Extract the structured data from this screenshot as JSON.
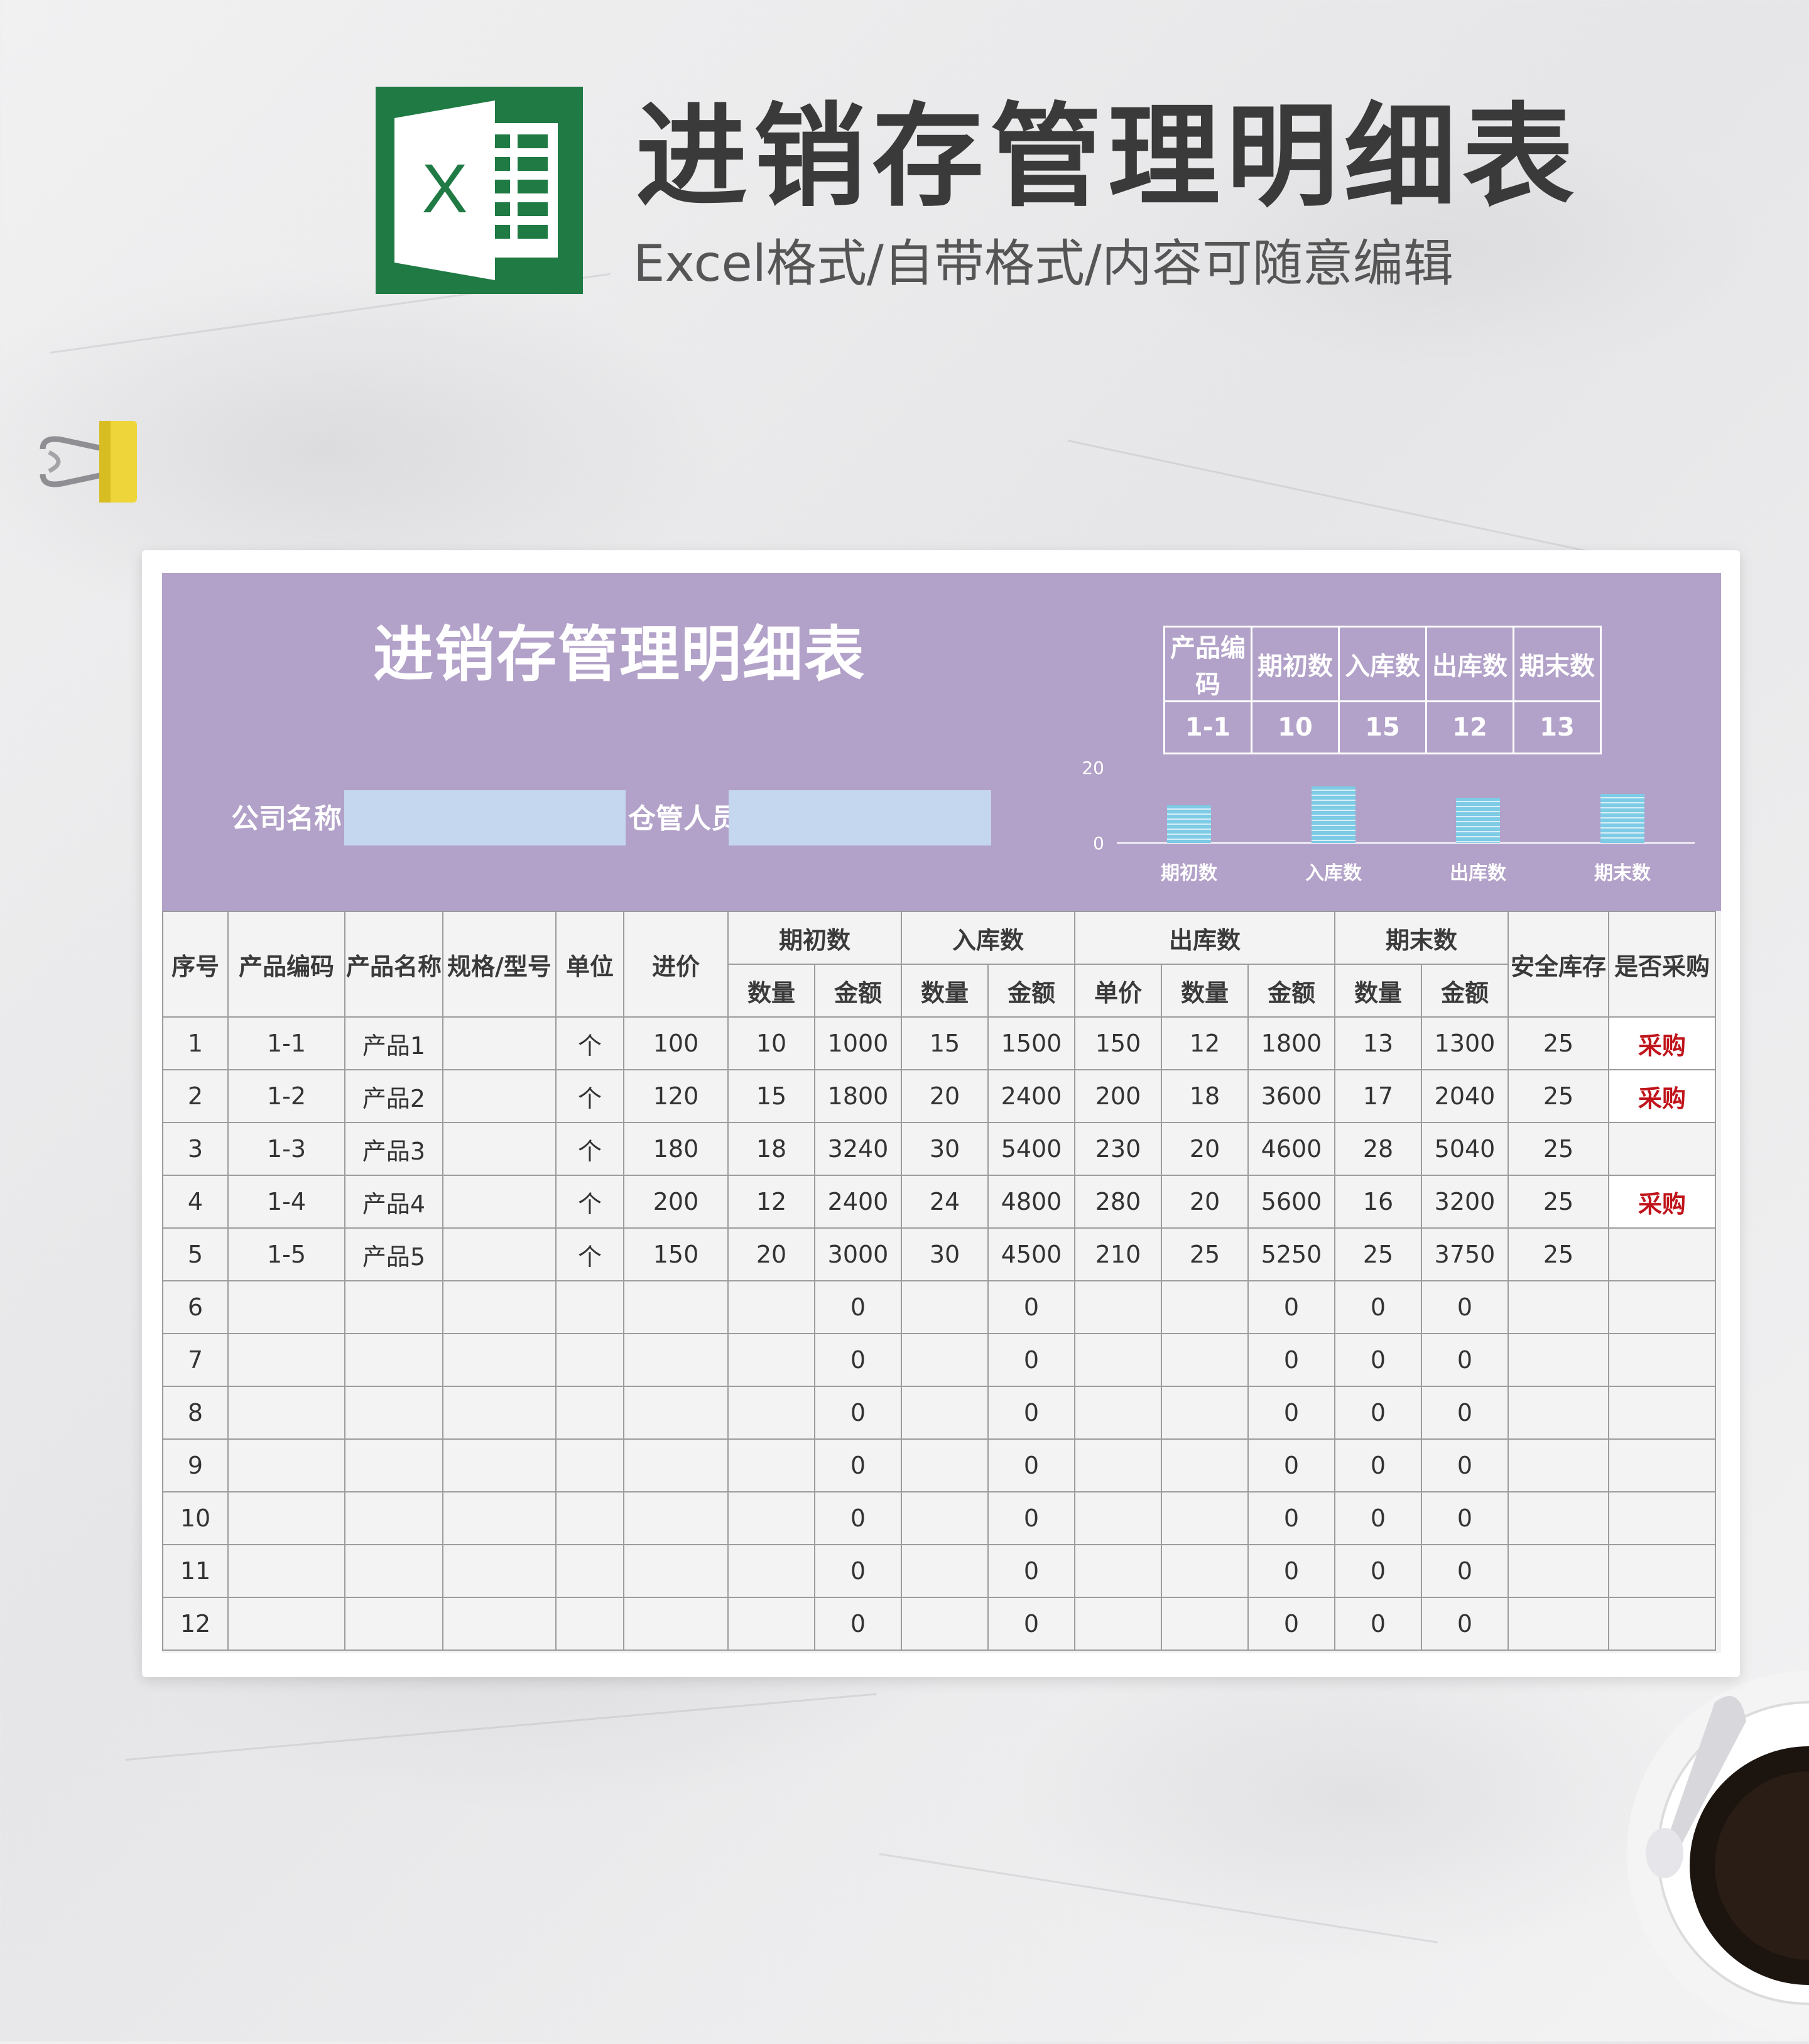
{
  "banner": {
    "title": "进销存管理明细表",
    "subtitle": "Excel格式/自带格式/内容可随意编辑",
    "logo_letter": "X"
  },
  "sheet": {
    "title": "进销存管理明细表",
    "company_label": "公司名称",
    "company_value": "",
    "keeper_label": "仓管人员",
    "keeper_value": "",
    "purple": "#b2a1c8",
    "input_blue": "#c4d7ef"
  },
  "summary": {
    "headers": [
      "产品编码",
      "期初数",
      "入库数",
      "出库数",
      "期末数"
    ],
    "values": [
      "1-1",
      "10",
      "15",
      "12",
      "13"
    ]
  },
  "chart_data": {
    "type": "bar",
    "categories": [
      "期初数",
      "入库数",
      "出库数",
      "期末数"
    ],
    "values": [
      10,
      15,
      12,
      13
    ],
    "ylim": [
      0,
      20
    ],
    "yticks": [
      "20",
      "0"
    ],
    "bar_color": "#7ecbe6",
    "grid": false
  },
  "table": {
    "headers": {
      "seq": "序号",
      "code": "产品编码",
      "name": "产品名称",
      "spec": "规格/型号",
      "unit": "单位",
      "price": "进价",
      "opening": "期初数",
      "inbound": "入库数",
      "outbound": "出库数",
      "closing": "期末数",
      "safety": "安全库存",
      "purchase": "是否采购",
      "qty": "数量",
      "amount": "金额",
      "unit_price": "单价"
    },
    "rows": [
      [
        "1",
        "1-1",
        "产品1",
        "",
        "个",
        "100",
        "10",
        "1000",
        "15",
        "1500",
        "150",
        "12",
        "1800",
        "13",
        "1300",
        "25",
        "采购"
      ],
      [
        "2",
        "1-2",
        "产品2",
        "",
        "个",
        "120",
        "15",
        "1800",
        "20",
        "2400",
        "200",
        "18",
        "3600",
        "17",
        "2040",
        "25",
        "采购"
      ],
      [
        "3",
        "1-3",
        "产品3",
        "",
        "个",
        "180",
        "18",
        "3240",
        "30",
        "5400",
        "230",
        "20",
        "4600",
        "28",
        "5040",
        "25",
        ""
      ],
      [
        "4",
        "1-4",
        "产品4",
        "",
        "个",
        "200",
        "12",
        "2400",
        "24",
        "4800",
        "280",
        "20",
        "5600",
        "16",
        "3200",
        "25",
        "采购"
      ],
      [
        "5",
        "1-5",
        "产品5",
        "",
        "个",
        "150",
        "20",
        "3000",
        "30",
        "4500",
        "210",
        "25",
        "5250",
        "25",
        "3750",
        "25",
        ""
      ],
      [
        "6",
        "",
        "",
        "",
        "",
        "",
        "",
        "0",
        "",
        "0",
        "",
        "",
        "0",
        "0",
        "0",
        "",
        ""
      ],
      [
        "7",
        "",
        "",
        "",
        "",
        "",
        "",
        "0",
        "",
        "0",
        "",
        "",
        "0",
        "0",
        "0",
        "",
        ""
      ],
      [
        "8",
        "",
        "",
        "",
        "",
        "",
        "",
        "0",
        "",
        "0",
        "",
        "",
        "0",
        "0",
        "0",
        "",
        ""
      ],
      [
        "9",
        "",
        "",
        "",
        "",
        "",
        "",
        "0",
        "",
        "0",
        "",
        "",
        "0",
        "0",
        "0",
        "",
        ""
      ],
      [
        "10",
        "",
        "",
        "",
        "",
        "",
        "",
        "0",
        "",
        "0",
        "",
        "",
        "0",
        "0",
        "0",
        "",
        ""
      ],
      [
        "11",
        "",
        "",
        "",
        "",
        "",
        "",
        "0",
        "",
        "0",
        "",
        "",
        "0",
        "0",
        "0",
        "",
        ""
      ],
      [
        "12",
        "",
        "",
        "",
        "",
        "",
        "",
        "0",
        "",
        "0",
        "",
        "",
        "0",
        "0",
        "0",
        "",
        ""
      ]
    ]
  }
}
